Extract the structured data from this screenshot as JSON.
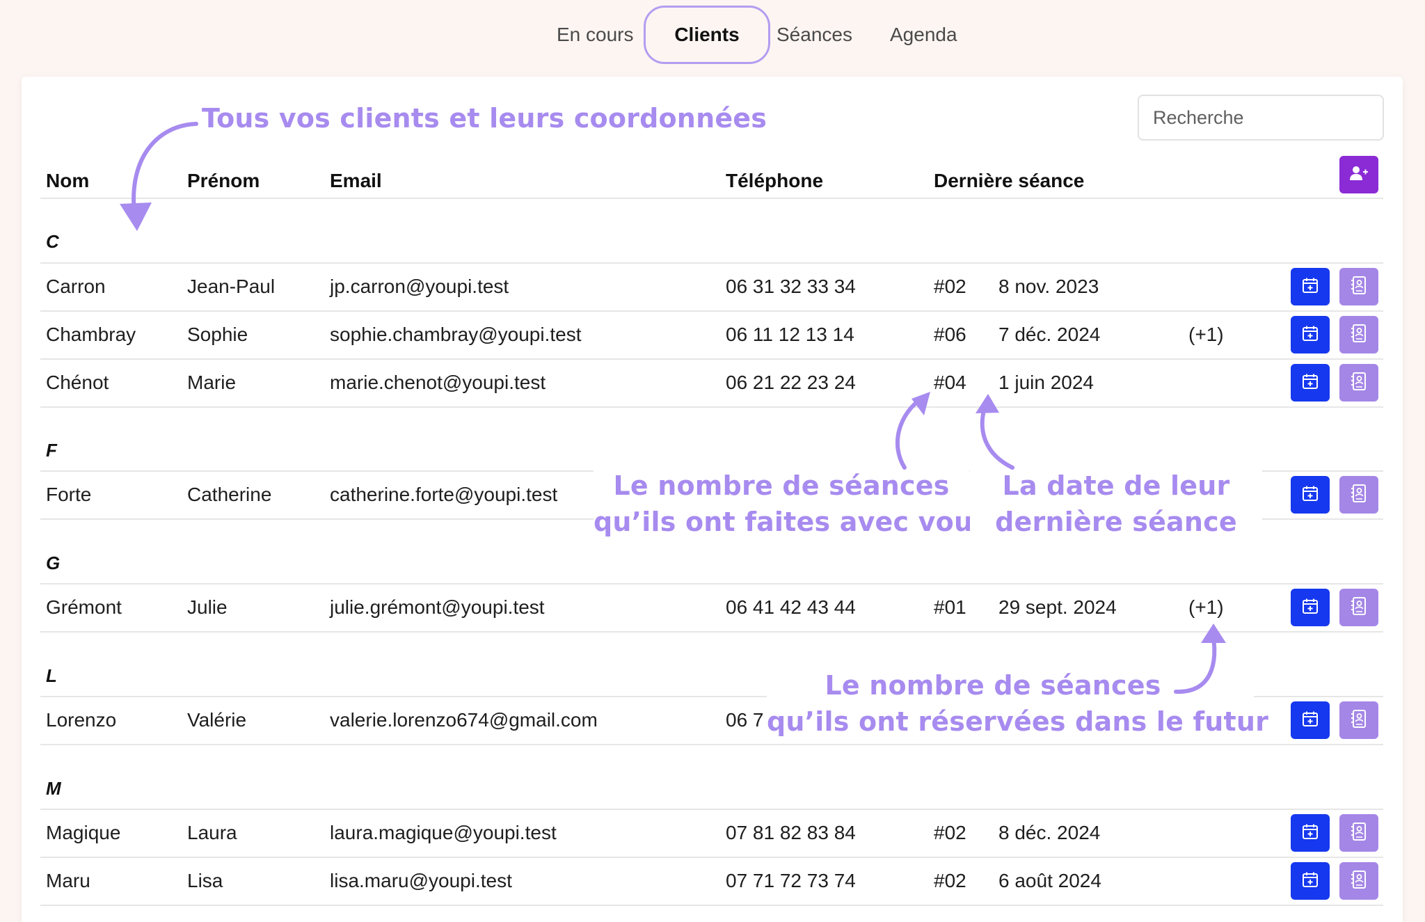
{
  "tabs": [
    {
      "label": "En cours"
    },
    {
      "label": "Clients"
    },
    {
      "label": "Séances"
    },
    {
      "label": "Agenda"
    }
  ],
  "search": {
    "placeholder": "Recherche"
  },
  "columns": {
    "nom": "Nom",
    "prenom": "Prénom",
    "email": "Email",
    "telephone": "Téléphone",
    "derniere_seance": "Dernière séance"
  },
  "groups": [
    {
      "letter": "C",
      "clients": [
        {
          "nom": "Carron",
          "prenom": "Jean-Paul",
          "email": "jp.carron@youpi.test",
          "telephone": "06 31 32 33 34",
          "seances": "#02",
          "date": "8 nov. 2023",
          "futur": ""
        },
        {
          "nom": "Chambray",
          "prenom": "Sophie",
          "email": "sophie.chambray@youpi.test",
          "telephone": "06 11 12 13 14",
          "seances": "#06",
          "date": "7 déc. 2024",
          "futur": "(+1)"
        },
        {
          "nom": "Chénot",
          "prenom": "Marie",
          "email": "marie.chenot@youpi.test",
          "telephone": "06 21 22 23 24",
          "seances": "#04",
          "date": "1 juin 2024",
          "futur": ""
        }
      ]
    },
    {
      "letter": "F",
      "clients": [
        {
          "nom": "Forte",
          "prenom": "Catherine",
          "email": "catherine.forte@youpi.test",
          "telephone": "",
          "seances": "",
          "date": "",
          "futur": ""
        }
      ]
    },
    {
      "letter": "G",
      "clients": [
        {
          "nom": "Grémont",
          "prenom": "Julie",
          "email": "julie.grémont@youpi.test",
          "telephone": "06 41 42 43 44",
          "seances": "#01",
          "date": "29 sept. 2024",
          "futur": "(+1)"
        }
      ]
    },
    {
      "letter": "L",
      "clients": [
        {
          "nom": "Lorenzo",
          "prenom": "Valérie",
          "email": "valerie.lorenzo674@gmail.com",
          "telephone": "06 7",
          "seances": "",
          "date": "",
          "futur": ""
        }
      ]
    },
    {
      "letter": "M",
      "clients": [
        {
          "nom": "Magique",
          "prenom": "Laura",
          "email": "laura.magique@youpi.test",
          "telephone": "07 81 82 83 84",
          "seances": "#02",
          "date": "8 déc. 2024",
          "futur": ""
        },
        {
          "nom": "Maru",
          "prenom": "Lisa",
          "email": "lisa.maru@youpi.test",
          "telephone": "07 71 72 73 74",
          "seances": "#02",
          "date": "6 août 2024",
          "futur": ""
        }
      ]
    }
  ],
  "annotations": {
    "clients": "Tous vos clients et leurs coordonnées",
    "nb_seances_l1": "Le nombre de séances",
    "nb_seances_l2": "qu’ils ont faites avec vous",
    "date_l1": "La date de leur",
    "date_l2": "dernière séance",
    "futur_l1": "Le nombre de séances",
    "futur_l2": "qu’ils ont réservées dans le futur"
  },
  "colors": {
    "accent": "#a78bef",
    "calendar_button": "#1638ef",
    "contact_button": "#a486e6",
    "add_button": "#8a2bd6",
    "background": "#fdf5f2"
  },
  "icons": {
    "add": "user-plus-icon",
    "calendar": "calendar-plus-icon",
    "contact": "contact-card-icon"
  }
}
